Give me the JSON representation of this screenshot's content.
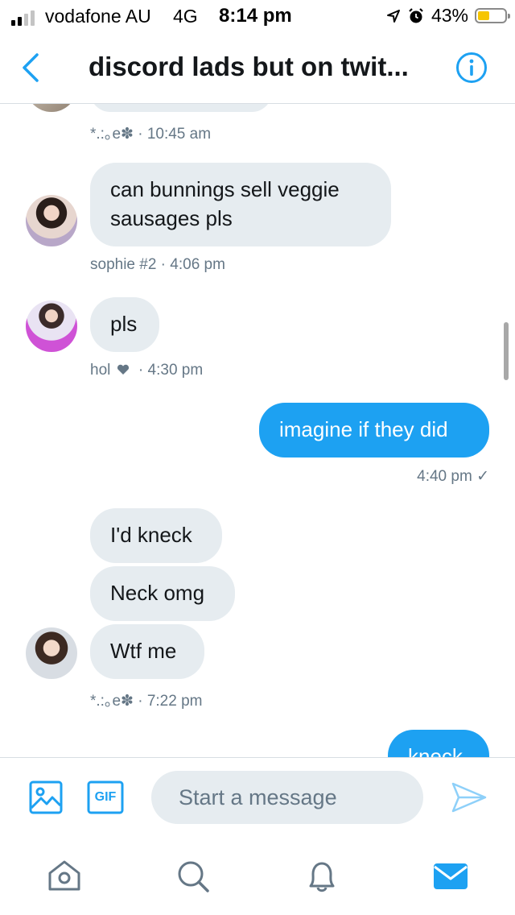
{
  "status_bar": {
    "carrier": "vodafone AU",
    "network": "4G",
    "time": "8:14 pm",
    "battery_percent": "43%",
    "signal_bars_filled": 2,
    "signal_bars_total": 4,
    "battery_level": 0.43
  },
  "header": {
    "title": "discord lads but on twit...",
    "back_icon": "chevron-left-icon",
    "info_icon": "info-icon"
  },
  "messages": [
    {
      "direction": "in",
      "text": "",
      "meta": "*.:｡e✽ · 10:45 am",
      "partial": true
    },
    {
      "direction": "in",
      "text": "can bunnings sell veggie sausages pls",
      "line1": "can bunnings sell veggie",
      "line2": "sausages pls",
      "meta": "sophie #2  · 4:06 pm"
    },
    {
      "direction": "in",
      "text": "pls",
      "meta_name": "hol",
      "meta_time": "· 4:30 pm"
    },
    {
      "direction": "out",
      "text": "imagine if they did",
      "meta": "4:40 pm ✓"
    },
    {
      "direction": "in",
      "text": "I'd kneck"
    },
    {
      "direction": "in",
      "text": "Neck omg"
    },
    {
      "direction": "in",
      "text": "Wtf me",
      "meta": "*.:｡e✽ · 7:22 pm"
    },
    {
      "direction": "out",
      "text": "kneck",
      "partial": true
    }
  ],
  "composer": {
    "placeholder": "Start a message",
    "gif_label": "GIF",
    "image_icon": "image-icon",
    "send_icon": "send-icon"
  },
  "tab_bar": [
    {
      "name": "home",
      "icon": "home-icon",
      "active": false
    },
    {
      "name": "search",
      "icon": "search-icon",
      "active": false
    },
    {
      "name": "notifications",
      "icon": "bell-icon",
      "active": false
    },
    {
      "name": "messages",
      "icon": "mail-icon",
      "active": true
    }
  ],
  "colors": {
    "accent": "#1da1f2",
    "incoming_bubble": "#e6ecf0",
    "meta_text": "#657786",
    "icon_gray": "#657786"
  }
}
